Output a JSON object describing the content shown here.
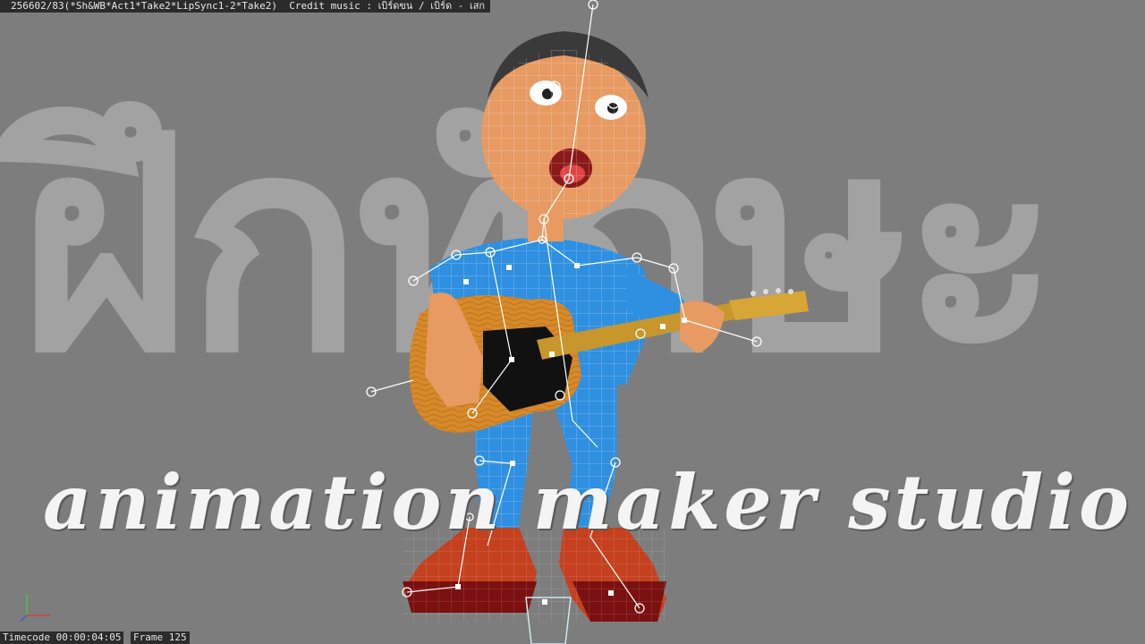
{
  "title_bar": {
    "text": "256602/83(*Sh&WB*Act1*Take2*LipSync1-2*Take2)  Credit music : เบิร์ดขน / เบิร์ด - เสก"
  },
  "watermark": {
    "thai_text": "ฝึกทักษะ",
    "studio_text": "animation maker studio"
  },
  "hud": {
    "timecode": "Timecode 00:00:04:05",
    "frame": "Frame 125"
  },
  "icons": {
    "axis": "axis-gizmo-icon",
    "character": "rigged-guitarist-character"
  },
  "colors": {
    "viewport_bg": "#7d7d7d",
    "hud_bg": "#2b2b2b",
    "skin": "#e79a62",
    "shirt": "#2f8fe0",
    "shoes": "#c4401e",
    "guitar_body": "#d68a2a"
  }
}
